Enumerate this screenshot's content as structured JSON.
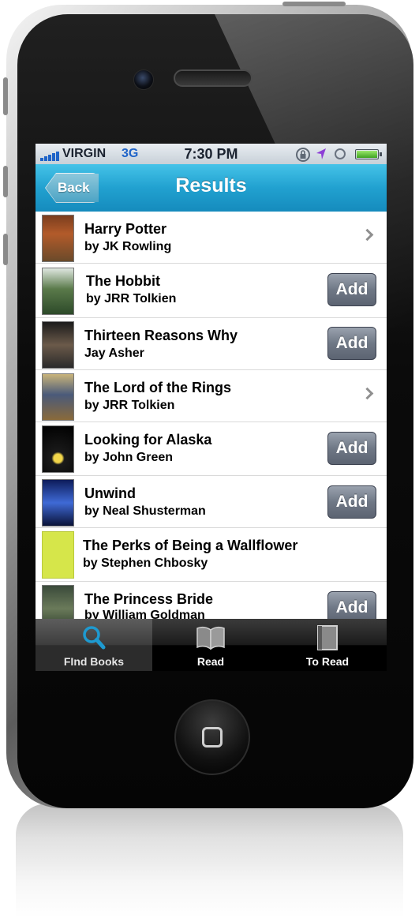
{
  "status_bar": {
    "carrier": "VIRGIN",
    "network": "3G",
    "time": "7:30 PM"
  },
  "nav": {
    "back_label": "Back",
    "title": "Results"
  },
  "books": [
    {
      "title": "Harry Potter",
      "author": "by JK Rowling",
      "action": "chevron"
    },
    {
      "title": "The Hobbit",
      "author": "by JRR Tolkien",
      "action": "add"
    },
    {
      "title": "Thirteen Reasons Why",
      "author": "Jay Asher",
      "action": "add"
    },
    {
      "title": "The Lord of the Rings",
      "author": "by JRR Tolkien",
      "action": "chevron"
    },
    {
      "title": "Looking for Alaska",
      "author": "by John Green",
      "action": "add"
    },
    {
      "title": "Unwind",
      "author": "by Neal Shusterman",
      "action": "add"
    },
    {
      "title": "The Perks of Being a Wallflower",
      "author": "by Stephen Chbosky",
      "action": "none"
    },
    {
      "title": "The Princess Bride",
      "author": "by William Goldman",
      "action": "add"
    }
  ],
  "add_label": "Add",
  "tabs": [
    {
      "label": "FInd Books",
      "icon": "magnifier-icon",
      "active": true
    },
    {
      "label": "Read",
      "icon": "open-book-icon",
      "active": false
    },
    {
      "label": "To Read",
      "icon": "closed-book-icon",
      "active": false
    }
  ],
  "colors": {
    "nav_blue": "#21a1d0",
    "carrier_blue": "#1e63c8",
    "add_button_gray": "#6f7886",
    "tab_icon_blue": "#1e9ad0"
  }
}
